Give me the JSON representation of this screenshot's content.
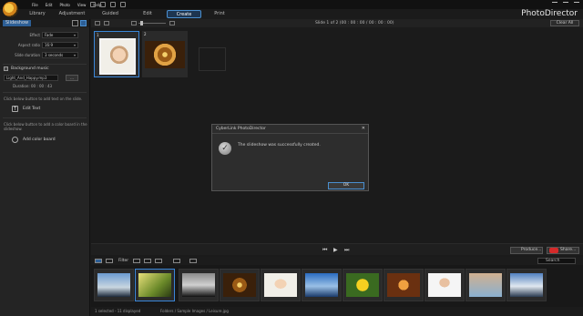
{
  "menu": [
    "File",
    "Edit",
    "Photo",
    "View",
    "Help"
  ],
  "app_name": "PhotoDirector",
  "tabs": {
    "library": "Library",
    "adjustment": "Adjustment",
    "guided": "Guided",
    "edit": "Edit",
    "create": "Create",
    "print": "Print"
  },
  "left_panel": {
    "header": "Slideshow",
    "effect": {
      "label": "Effect",
      "value": "Fade"
    },
    "aspect_ratio": {
      "label": "Aspect ratio",
      "value": "16:9"
    },
    "slide_duration": {
      "label": "Slide duration",
      "value": "3 seconds"
    },
    "background_music": {
      "label": "Background music",
      "file": "Light_And_Happy.mp3",
      "button": "...",
      "duration": "Duration: 00 : 00 : 43"
    },
    "text_hint": "Click below button to add text on the slide.",
    "edit_text": "Edit Text",
    "color_hint": "Click below button to add a color board in the slideshow.",
    "add_color_board": "Add color board"
  },
  "toolbar": {
    "slide_info": "Slide   1  of  2 (00 : 00 : 00 / 00 : 00 : 00)",
    "clear_all": "Clear All"
  },
  "slides": [
    {
      "num": "1"
    },
    {
      "num": "2"
    }
  ],
  "dialog": {
    "title": "CyberLink PhotoDirector",
    "close": "✕",
    "message": "The slideshow was successfully created.",
    "ok": "OK"
  },
  "playbar": {
    "produce": "Produce...",
    "share": "Share..."
  },
  "filterbar": {
    "filter_label": "Filter",
    "search_placeholder": "Search"
  },
  "status": {
    "selected": "1 selected - 11 displayed",
    "path": "Folders / Sample Images / Leisure.jpg"
  },
  "colors": {
    "accent": "#3a86d8",
    "background": "#1b1b1b",
    "panel": "#242424",
    "share_red": "#d52a2a"
  }
}
